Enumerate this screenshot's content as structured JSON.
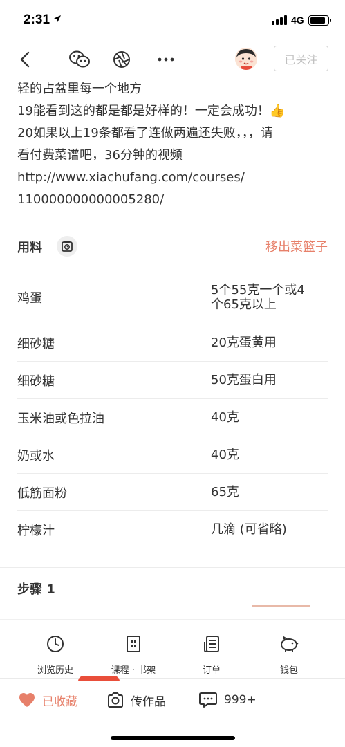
{
  "status_bar": {
    "time": "2:31",
    "network": "4G"
  },
  "navbar": {
    "back_icon": "chevron-left-icon",
    "wechat_icon": "wechat-icon",
    "moments_icon": "aperture-icon",
    "more_icon": "more-dots-icon",
    "follow_label": "已关注"
  },
  "description": {
    "lines": [
      "轻的占盆里每一个地方",
      "19能看到这的都是都是好样的！一定会成功！👍",
      "20如果以上19条都看了连做两遍还失败，，，请",
      "看付费菜谱吧，36分钟的视频",
      "http://www.xiachufang.com/courses/",
      "110000000000005280/"
    ]
  },
  "ingredients": {
    "title": "用料",
    "remove_basket": "移出菜篮子",
    "items": [
      {
        "name": "鸡蛋",
        "amount_line1": "5个55克一个或4",
        "amount_line2": "个65克以上"
      },
      {
        "name": "细砂糖",
        "amount_line1": "20克蛋黄用",
        "amount_line2": ""
      },
      {
        "name": "细砂糖",
        "amount_line1": "50克蛋白用",
        "amount_line2": ""
      },
      {
        "name": "玉米油或色拉油",
        "amount_line1": "40克",
        "amount_line2": ""
      },
      {
        "name": "奶或水",
        "amount_line1": "40克",
        "amount_line2": ""
      },
      {
        "name": "低筋面粉",
        "amount_line1": "65克",
        "amount_line2": ""
      },
      {
        "name": "柠檬汁",
        "amount_line1": "几滴 (可省略)",
        "amount_line2": ""
      }
    ]
  },
  "steps": {
    "title": "步骤 1"
  },
  "quick_menu": {
    "items": [
      {
        "label": "浏览历史",
        "icon": "clock-icon"
      },
      {
        "label": "课程 · 书架",
        "icon": "book-icon"
      },
      {
        "label": "订单",
        "icon": "order-list-icon"
      },
      {
        "label": "钱包",
        "icon": "piggy-bank-icon"
      }
    ]
  },
  "bottom_bar": {
    "favorite_label": "已收藏",
    "upload_label": "传作品",
    "comments_label": "999+"
  },
  "colors": {
    "accent": "#e7806a",
    "text": "#333333",
    "divider": "#ececec"
  }
}
